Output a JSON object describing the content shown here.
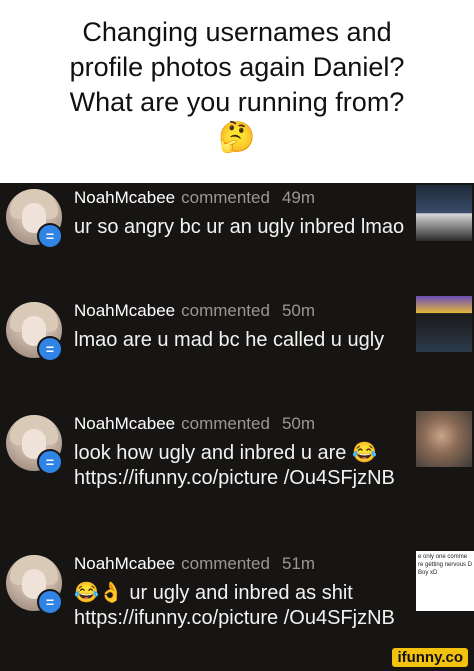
{
  "header": {
    "lines": [
      "Changing usernames and",
      "profile photos again Daniel?",
      "What are you running from?"
    ],
    "emoji": "🤔"
  },
  "notifications": [
    {
      "user": "NoahMcabee",
      "verb": "commented",
      "time": "49m",
      "text": "ur so angry bc ur an ugly inbred lmao"
    },
    {
      "user": "NoahMcabee",
      "verb": "commented",
      "time": "50m",
      "text": "lmao are u mad bc he called u ugly"
    },
    {
      "user": "NoahMcabee",
      "verb": "commented",
      "time": "50m",
      "text": "look how ugly and inbred u are 😂 https://ifunny.co/picture /Ou4SFjzNB"
    },
    {
      "user": "NoahMcabee",
      "verb": "commented",
      "time": "51m",
      "text": "😂👌 ur ugly and inbred as shit https://ifunny.co/picture /Ou4SFjzNB"
    }
  ],
  "thumb4_text": {
    "line1": "e only one comme",
    "line2": "re getting nervous D",
    "line3": "Boy xD"
  },
  "watermark": "ifunny.co",
  "colors": {
    "background": "#171513",
    "badge": "#2f84e6",
    "muted": "#9a9692"
  }
}
